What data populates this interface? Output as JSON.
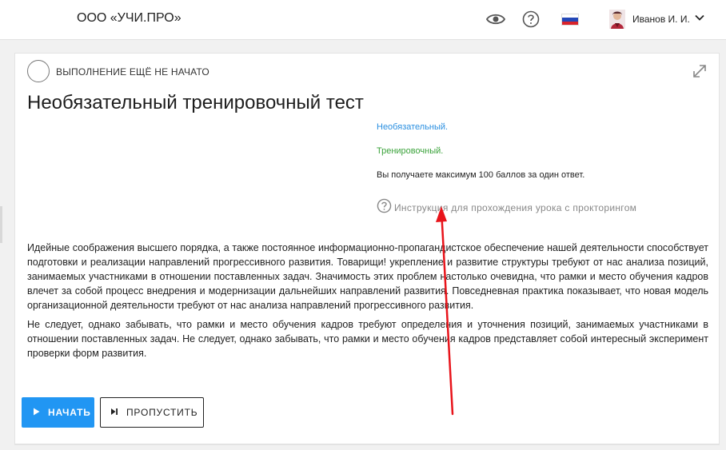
{
  "header": {
    "org_name": "ООО «УЧИ.ПРО»",
    "user_name": "Иванов И. И.",
    "icons": [
      "eye-icon",
      "help-icon",
      "russia-flag-icon",
      "avatar",
      "chevron-down-icon"
    ]
  },
  "lesson": {
    "status": "ВЫПОЛНЕНИЕ ЕЩЁ НЕ НАЧАТО",
    "title": "Необязательный тренировочный тест",
    "optional_label": "Необязательный.",
    "training_label": "Тренировочный.",
    "points_text": "Вы получаете максимум 100 баллов за один ответ.",
    "instruction_link": "Инструкция для прохождения урока с прокторингом",
    "paragraphs": [
      "Идейные соображения высшего порядка, а также постоянное информационно-пропагандистское обеспечение нашей деятельности способствует подготовки и реализации направлений прогрессивного развития. Товарищи! укрепление и развитие структуры требуют от нас анализа позиций, занимаемых участниками в отношении поставленных задач. Значимость этих проблем настолько очевидна, что рамки и место обучения кадров влечет за собой процесс внедрения и модернизации дальнейших направлений развития. Повседневная практика показывает, что новая модель организационной деятельности требуют от нас анализа направлений прогрессивного развития.",
      "Не следует, однако забывать, что рамки и место обучения кадров требуют определения и уточнения позиций, занимаемых участниками в отношении поставленных задач. Не следует, однако забывать, что рамки и место обучения кадров представляет собой интересный эксперимент проверки форм развития."
    ],
    "start_button": "НАЧАТЬ",
    "skip_button": "ПРОПУСТИТЬ"
  },
  "colors": {
    "accent_blue": "#2196f3",
    "optional_blue": "#2a8fe0",
    "training_green": "#3aa23a",
    "annotation_red": "#e8141b"
  }
}
